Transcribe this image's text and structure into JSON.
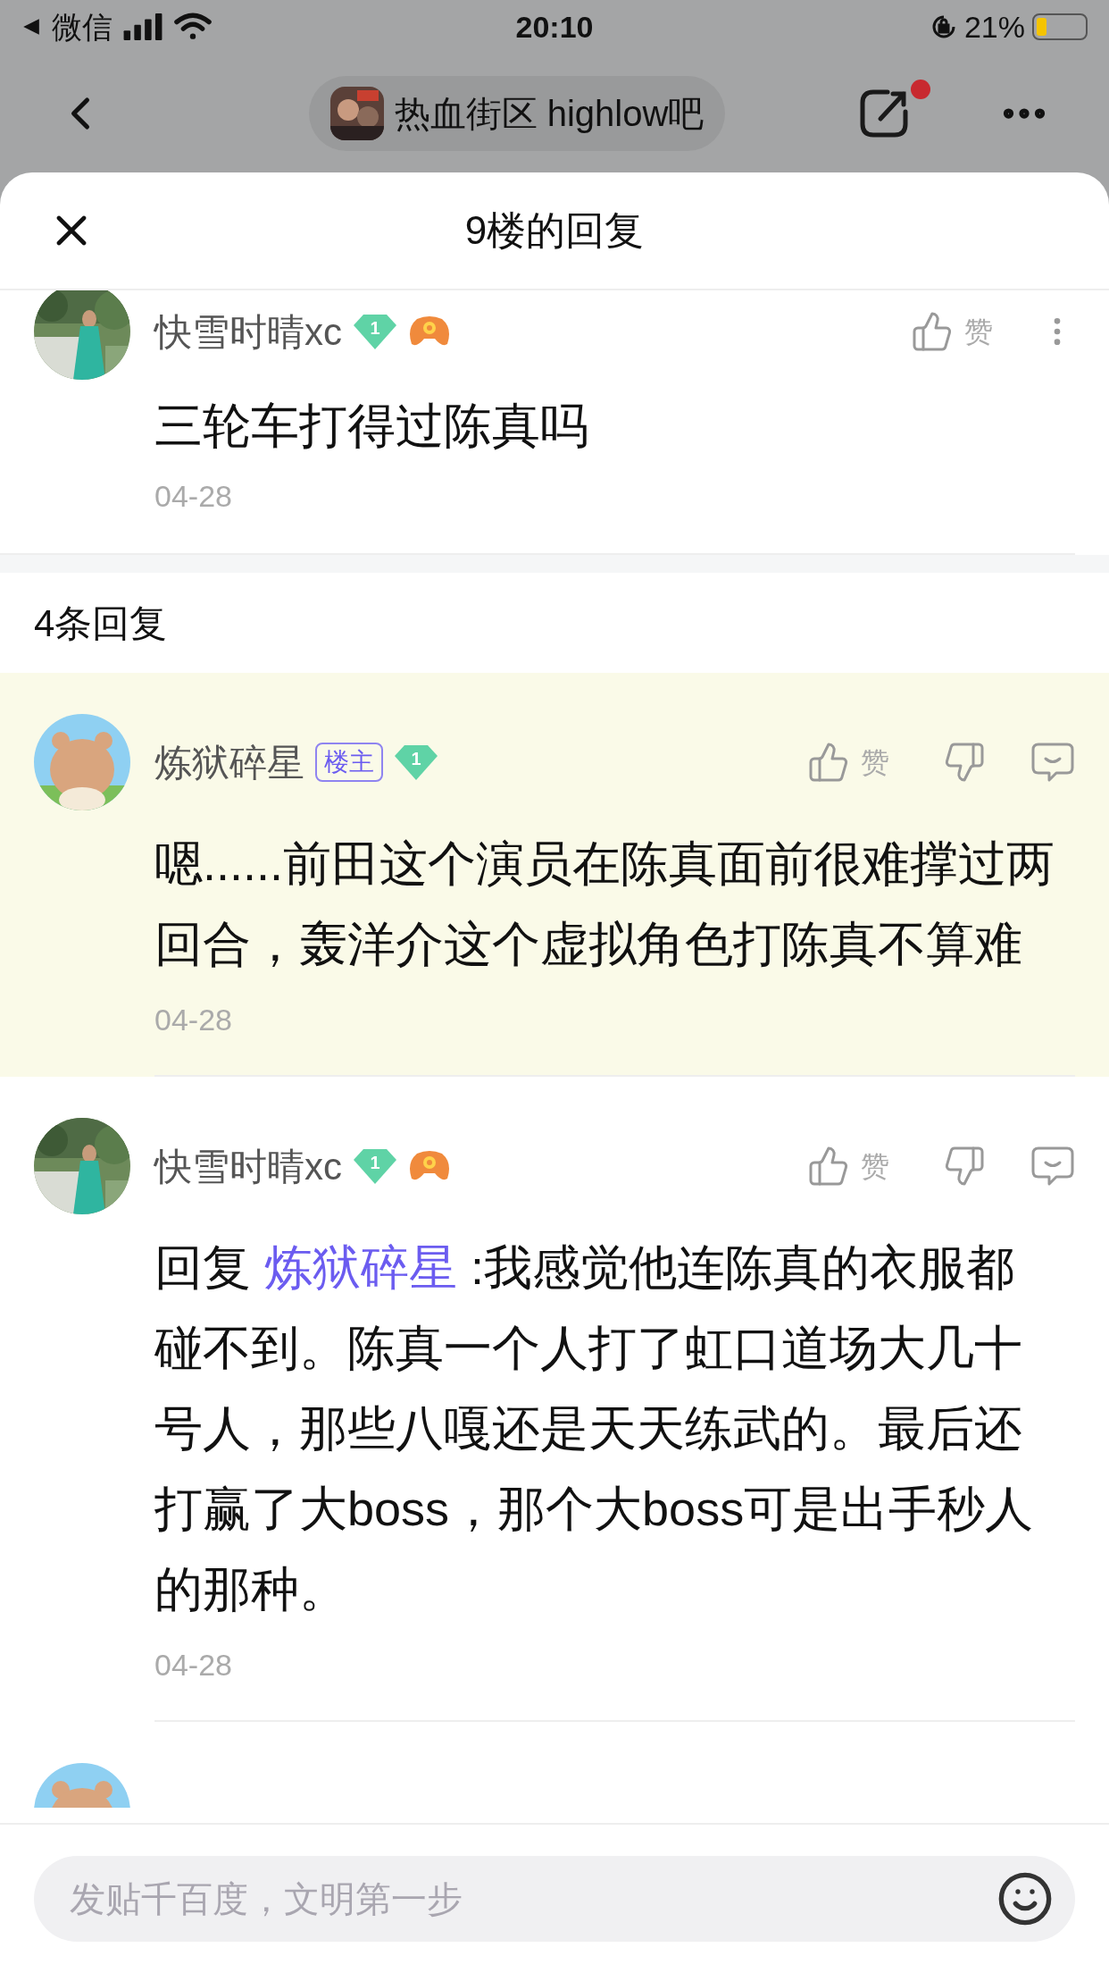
{
  "status_bar": {
    "back_app": "微信",
    "time": "20:10",
    "battery": "21%"
  },
  "nav": {
    "forum": "热血街区 highlow吧",
    "notification_dot": true
  },
  "sheet": {
    "title": "9楼的回复"
  },
  "post": {
    "author": "快雪时晴xc",
    "level": "1",
    "game_badge": true,
    "like": "赞",
    "text": "三轮车打得过陈真吗",
    "date": "04-28"
  },
  "replies_header": "4条回复",
  "replies": [
    {
      "kind": "cartoon",
      "author": "炼狱碎星",
      "op_badge": "楼主",
      "level": "1",
      "game_badge": false,
      "like": "赞",
      "highlighted": true,
      "text": "嗯......前田这个演员在陈真面前很难撑过两回合，轰洋介这个虚拟角色打陈真不算难",
      "date": "04-28"
    },
    {
      "author": "快雪时晴xc",
      "level": "1",
      "game_badge": true,
      "like": "赞",
      "highlighted": false,
      "prefix": "回复",
      "reply_to": "炼狱碎星",
      "text": ":我感觉他连陈真的衣服都碰不到。陈真一个人打了虹口道场大几十号人，那些八嘎还是天天练武的。最后还打赢了大boss，那个大boss可是出手秒人的那种。",
      "date": "04-28"
    },
    {
      "kind": "cut"
    }
  ],
  "input": {
    "placeholder": "发贴千百度，文明第一步"
  }
}
